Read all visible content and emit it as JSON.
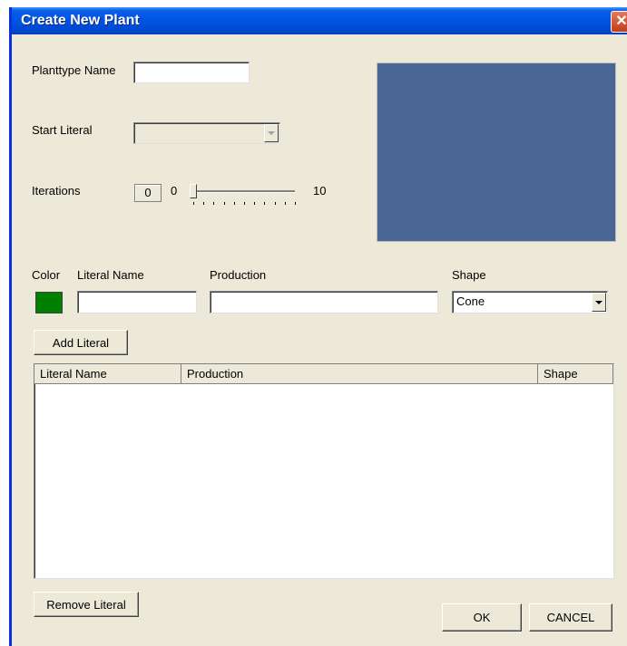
{
  "window": {
    "title": "Create New Plant",
    "close_glyph": "✕"
  },
  "form": {
    "planttype_label": "Planttype Name",
    "planttype_value": "",
    "start_literal_label": "Start Literal",
    "start_literal_value": "",
    "iterations_label": "Iterations",
    "iterations_value": "0",
    "slider_min_label": "0",
    "slider_max_label": "10",
    "slider_value": 0,
    "slider_range": [
      0,
      10
    ]
  },
  "preview": {
    "color": "#4b6695"
  },
  "literal_editor": {
    "color_label": "Color",
    "literal_name_label": "Literal Name",
    "production_label": "Production",
    "shape_label": "Shape",
    "swatch_color": "#008000",
    "literal_name_value": "",
    "production_value": "",
    "shape_value": "Cone",
    "add_button": "Add Literal"
  },
  "table": {
    "columns": [
      "Literal Name",
      "Production",
      "Shape"
    ],
    "rows": []
  },
  "buttons": {
    "remove": "Remove Literal",
    "ok": "OK",
    "cancel": "CANCEL"
  }
}
